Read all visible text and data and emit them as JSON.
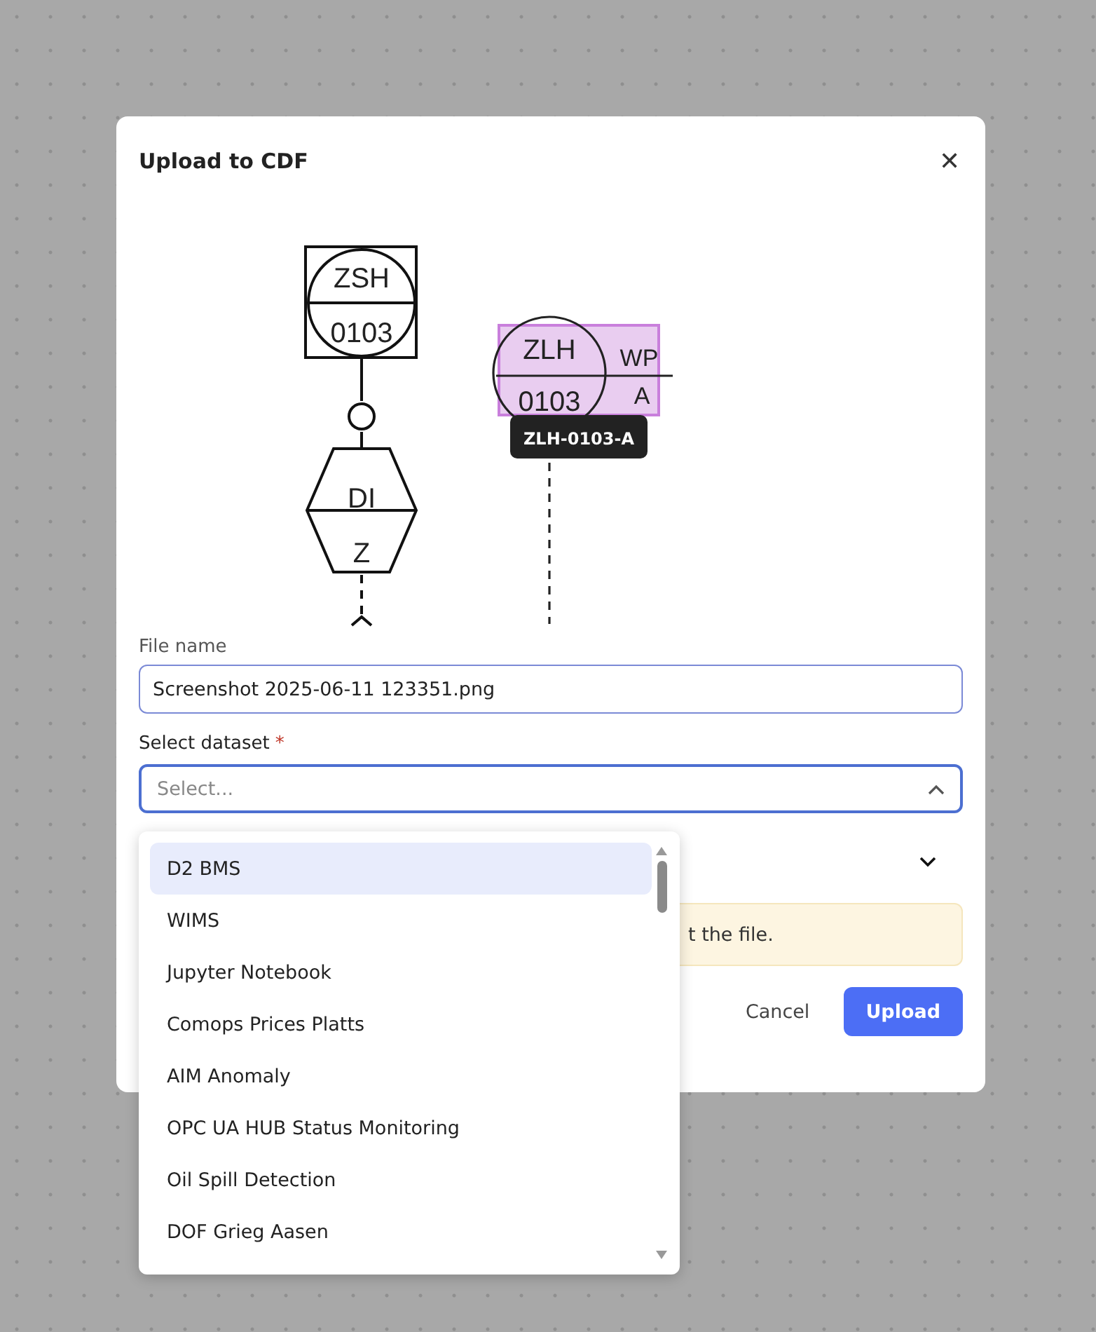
{
  "dialog": {
    "title": "Upload to CDF",
    "close": "✕"
  },
  "preview": {
    "labels": [
      "ZSH",
      "0103",
      "DI",
      "Z",
      "ZLH",
      "0103",
      "WP",
      "A"
    ],
    "tooltip": "ZLH-0103-A"
  },
  "file_name": {
    "label": "File name",
    "value": "Screenshot 2025-06-11 123351.png"
  },
  "dataset": {
    "label": "Select dataset",
    "required_mark": "*",
    "placeholder": "Select...",
    "expanded": true
  },
  "dropdown_options": [
    {
      "label": "D2 BMS",
      "selected": true
    },
    {
      "label": "WIMS",
      "selected": false
    },
    {
      "label": "Jupyter Notebook",
      "selected": false
    },
    {
      "label": "Comops Prices Platts",
      "selected": false
    },
    {
      "label": "AIM Anomaly",
      "selected": false
    },
    {
      "label": "OPC UA HUB Status Monitoring",
      "selected": false
    },
    {
      "label": "Oil Spill Detection",
      "selected": false
    },
    {
      "label": "DOF Grieg Aasen",
      "selected": false
    }
  ],
  "collapsed_field": {
    "expanded": false
  },
  "warning": {
    "text": "t the file."
  },
  "buttons": {
    "cancel": "Cancel",
    "upload": "Upload"
  }
}
